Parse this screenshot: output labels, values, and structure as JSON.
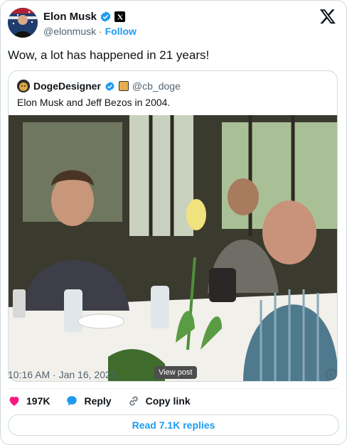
{
  "author": {
    "name": "Elon Musk",
    "handle": "@elonmusk",
    "separator": "·",
    "follow_label": "Follow",
    "verified_color": "#1d9bf0"
  },
  "tweet": {
    "text": "Wow, a lot has happened in 21 years!"
  },
  "quoted": {
    "name": "DogeDesigner",
    "handle": "@cb_doge",
    "text": "Elon Musk and Jeff Bezos in 2004.",
    "view_post_label": "View post"
  },
  "meta": {
    "timestamp": "10:16 AM · Jan 16, 2025"
  },
  "actions": {
    "likes": "197K",
    "reply_label": "Reply",
    "copy_label": "Copy link"
  },
  "read_replies_label": "Read 7.1K replies",
  "icons": {
    "brand": "x-logo-icon",
    "verified": "verified-badge-icon",
    "like": "heart-icon",
    "reply": "speech-bubble-icon",
    "copy": "link-icon",
    "info": "info-icon"
  },
  "colors": {
    "accent": "#1d9bf0",
    "like": "#f91880",
    "muted": "#536471"
  }
}
